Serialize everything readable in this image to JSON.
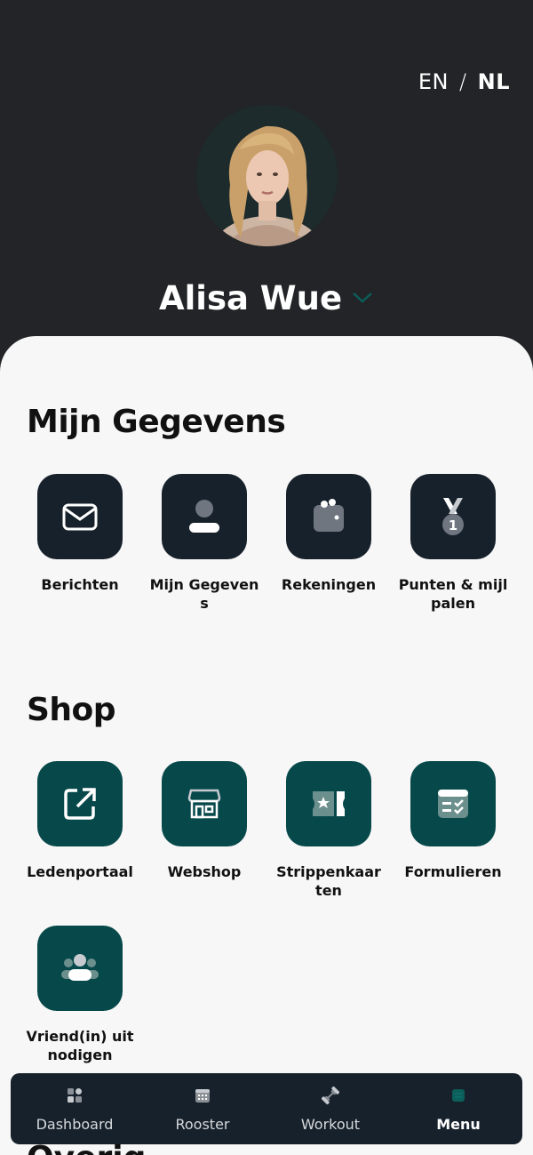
{
  "header": {
    "lang_en": "EN",
    "lang_sep": "/",
    "lang_nl": "NL",
    "user_name": "Alisa Wue"
  },
  "sections": {
    "mijn_gegevens": {
      "title": "Mijn Gegevens",
      "items": [
        {
          "label": "Berichten",
          "icon": "mail-icon"
        },
        {
          "label": "Mijn Gegevens",
          "icon": "user-icon"
        },
        {
          "label": "Rekeningen",
          "icon": "wallet-icon"
        },
        {
          "label": "Punten & mijlpalen",
          "icon": "medal-icon"
        }
      ]
    },
    "shop": {
      "title": "Shop",
      "items": [
        {
          "label": "Ledenportaal",
          "icon": "external-link-icon"
        },
        {
          "label": "Webshop",
          "icon": "store-icon"
        },
        {
          "label": "Strippenkaarten",
          "icon": "ticket-icon"
        },
        {
          "label": "Formulieren",
          "icon": "form-icon"
        },
        {
          "label": "Vriend(in) uitnodigen",
          "icon": "group-icon"
        }
      ]
    },
    "next": {
      "title": "Overig"
    }
  },
  "nav": {
    "items": [
      {
        "label": "Dashboard",
        "icon": "dashboard-icon"
      },
      {
        "label": "Rooster",
        "icon": "calendar-icon"
      },
      {
        "label": "Workout",
        "icon": "dumbbell-icon"
      },
      {
        "label": "Menu",
        "icon": "menu-icon",
        "active": true
      }
    ]
  },
  "colors": {
    "header_bg": "#222427",
    "tile_dark": "#17212b",
    "tile_green": "#07494b",
    "sheet_bg": "#f7f7f7",
    "accent_teal": "#0b5e5a"
  }
}
